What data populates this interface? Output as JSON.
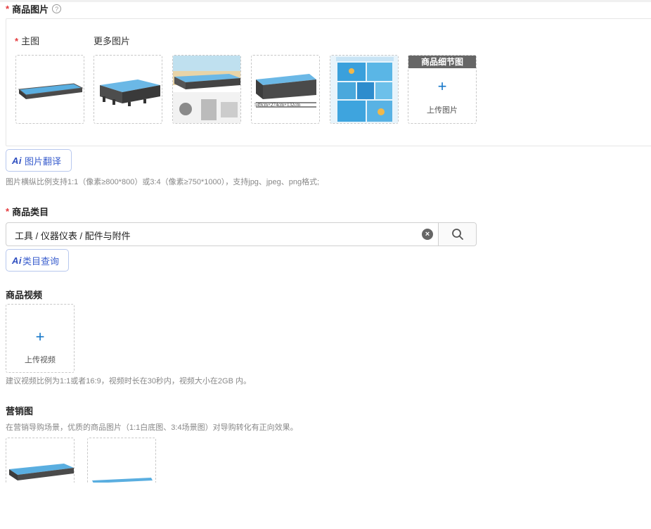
{
  "product_images": {
    "label": "商品图片",
    "required_mark": "*",
    "main_image_label": "主图",
    "more_images_label": "更多图片",
    "detail_tag": "商品细节图",
    "upload_text": "上传图片",
    "thumbs": [
      {
        "alt": "pool-main-image",
        "type": "pool"
      },
      {
        "alt": "pool-side-view",
        "type": "pool2"
      },
      {
        "alt": "pool-accessories",
        "type": "pool3"
      },
      {
        "alt": "pool-dimensions",
        "type": "pool4"
      },
      {
        "alt": "pool-scenes-collage",
        "type": "collage"
      }
    ],
    "dims_text": "549cm×274cm×132cm"
  },
  "ai_translate": {
    "logo": "Ai",
    "label": "图片翻译"
  },
  "image_hint": "图片横纵比例支持1:1（像素≥800*800）或3:4（像素≥750*1000），支持jpg、jpeg、png格式;",
  "category": {
    "label": "商品类目",
    "required_mark": "*",
    "value": "工具 / 仪器仪表 / 配件与附件"
  },
  "ai_category": {
    "logo": "Ai",
    "label": "类目查询"
  },
  "video": {
    "label": "商品视频",
    "upload_text": "上传视频",
    "hint": "建议视频比例为1:1或者16:9，视频时长在30秒内，视频大小在2GB 内。"
  },
  "marketing": {
    "label": "营销图",
    "hint": "在营销导购场景，优质的商品图片（1:1白底图、3:4场景图）对导购转化有正向效果。"
  },
  "icons": [
    "help-icon",
    "plus-icon",
    "clear-icon",
    "search-icon"
  ],
  "colors": {
    "required": "#e4393c",
    "accent": "#1677c9",
    "ai": "#3b5fce"
  }
}
